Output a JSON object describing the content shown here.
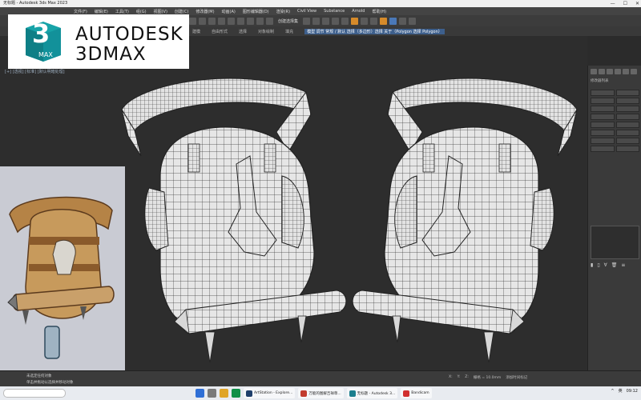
{
  "window": {
    "title": "无标题 - Autodesk 3ds Max 2023",
    "controls": [
      "—",
      "☐",
      "✕"
    ]
  },
  "menu": [
    "文件(F)",
    "编辑(E)",
    "工具(T)",
    "组(G)",
    "视图(V)",
    "创建(C)",
    "修改器(M)",
    "动画(A)",
    "图形编辑器(D)",
    "渲染(R)",
    "Civil View",
    "Substance",
    "Arnold",
    "帮助(H)"
  ],
  "toolbar": {
    "selection_set": "创建选择集"
  },
  "ribbon": [
    "建模",
    "自由形式",
    "选择",
    "对象绘制",
    "填充"
  ],
  "ribbon_highlight": "模型 调节 常规 / 默认 选择（多边形）选择 关于（Polygon 选择 Polygon）",
  "logo": {
    "line1": "AUTODESK",
    "line2": "3DMAX",
    "badge_number": "3",
    "badge_text": "MAX"
  },
  "viewport": {
    "label": "[+] [透视] [标准] [默认明暗处理]"
  },
  "command_panel": {
    "label": "修改器列表"
  },
  "status": {
    "line1": "未选定任何对象",
    "line2": "单击并拖动以选择并移动对象",
    "right": [
      "X:",
      "Y:",
      "Z:",
      "栅格 = 10.0mm",
      "添加时间标记"
    ]
  },
  "taskbar": {
    "apps": [
      {
        "name": "ArtStation - Explore...",
        "color": "#1f3f6b"
      },
      {
        "name": "万能的图解吉祥草...",
        "color": "#c23b2e"
      },
      {
        "name": "无标题 - Autodesk 3...",
        "color": "#1c7f8e"
      },
      {
        "name": "Bandicam",
        "color": "#d12f2f"
      }
    ],
    "tray": [
      "^",
      "英",
      "09:12"
    ]
  },
  "colors": {
    "wire": "#2a2a2a",
    "mesh": "#e9e9e9",
    "accent": "#4a78b8"
  }
}
